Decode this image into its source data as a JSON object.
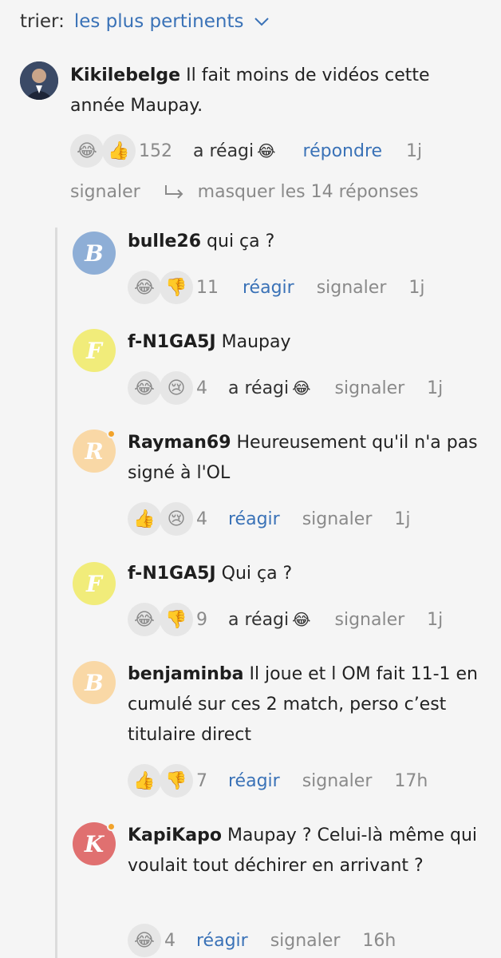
{
  "sort": {
    "label": "trier:",
    "value": "les plus pertinents"
  },
  "comment": {
    "user": "Kikilebelge",
    "text": "Il fait moins de vidéos cette année Maupay.",
    "reactions": [
      "😂",
      "👍"
    ],
    "count": "152",
    "reacted_label": "a réagi",
    "reacted_emoji": "😂",
    "reply_label": "répondre",
    "time": "1j",
    "report_label": "signaler",
    "hide_replies_label": "masquer les 14 réponses"
  },
  "replies": [
    {
      "initial": "B",
      "color": "#8eaed6",
      "badge": false,
      "user": "bulle26",
      "text": "qui ça ?",
      "reactions": [
        "😂",
        "👎"
      ],
      "count": "11",
      "action": "réagir",
      "action_emoji": "",
      "report": "signaler",
      "time": "1j"
    },
    {
      "initial": "F",
      "color": "#f1ec7a",
      "badge": false,
      "user": "f-N1GA5J",
      "text": "Maupay",
      "reactions": [
        "😂",
        "😢"
      ],
      "count": "4",
      "action": "a réagi",
      "action_emoji": "😂",
      "report": "signaler",
      "time": "1j"
    },
    {
      "initial": "R",
      "color": "#f9d8a6",
      "badge": true,
      "user": "Rayman69",
      "text": "Heureusement qu'il n'a pas signé à l'OL",
      "reactions": [
        "👍",
        "😢"
      ],
      "count": "4",
      "action": "réagir",
      "action_emoji": "",
      "report": "signaler",
      "time": "1j"
    },
    {
      "initial": "F",
      "color": "#f1ec7a",
      "badge": false,
      "user": "f-N1GA5J",
      "text": "Qui ça ?",
      "reactions": [
        "😂",
        "👎"
      ],
      "count": "9",
      "action": "a réagi",
      "action_emoji": "😂",
      "report": "signaler",
      "time": "1j"
    },
    {
      "initial": "B",
      "color": "#f9d8a6",
      "badge": false,
      "user": "benjaminba",
      "text": "Il joue et l OM fait 11-1 en cumulé sur ces 2 match, perso c’est titulaire direct",
      "reactions": [
        "👍",
        "👎"
      ],
      "count": "7",
      "action": "réagir",
      "action_emoji": "",
      "report": "signaler",
      "time": "17h"
    },
    {
      "initial": "K",
      "color": "#e07070",
      "badge": true,
      "user": "KapiKapo",
      "text": "Maupay ? Celui-là même qui voulait tout déchirer en arrivant ?",
      "reactions": [
        "😂"
      ],
      "count": "4",
      "action": "réagir",
      "action_emoji": "",
      "report": "signaler",
      "time": "16h"
    }
  ],
  "colors": {
    "accent": "#3a72b7",
    "muted": "#8a8a8a",
    "background": "#f5f5f5"
  }
}
